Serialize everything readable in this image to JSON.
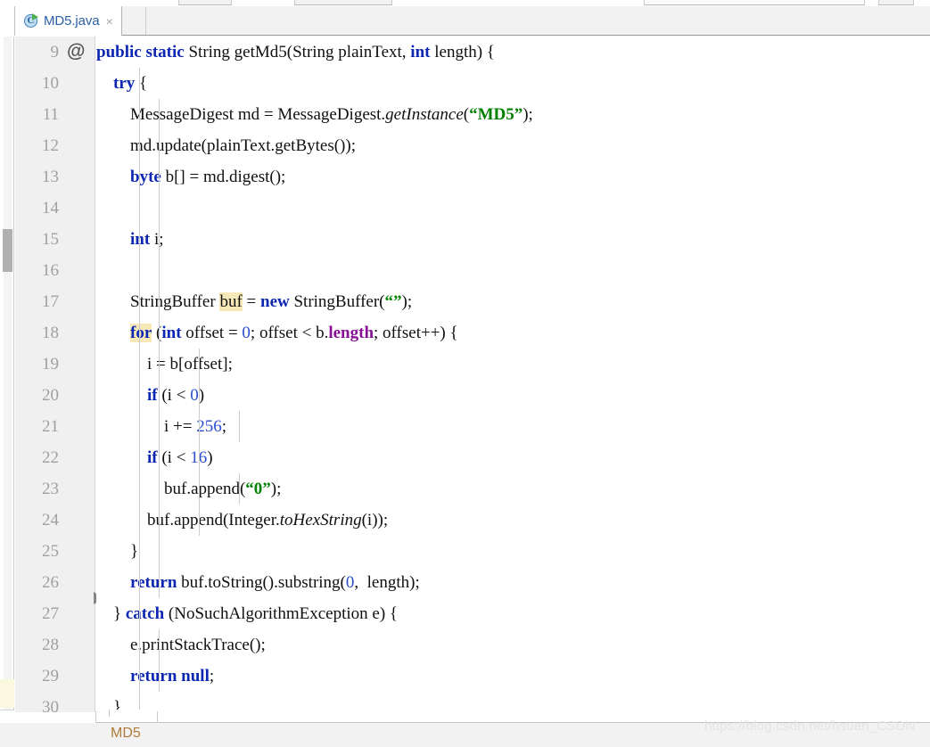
{
  "window": {
    "tab": {
      "title": "MD5.java",
      "icon": "java-class-runnable-icon",
      "icon_letter": "C",
      "close_label": "×"
    }
  },
  "gutter": {
    "line_numbers": [
      "9",
      "10",
      "11",
      "12",
      "13",
      "14",
      "15",
      "16",
      "17",
      "18",
      "19",
      "20",
      "21",
      "22",
      "23",
      "24",
      "25",
      "26",
      "27",
      "28",
      "29",
      "30"
    ],
    "annotation_marker": "@",
    "fold_collapse_icon": "fold-minus-icon",
    "fold_expand_icon": "fold-arrow-icon"
  },
  "status": {
    "breadcrumb": "MD5",
    "watermark": "https://blog.csdn.net/hsuan_CSDN"
  },
  "colors": {
    "keyword": "#0d27b3",
    "number": "#2a4dd0",
    "string": "#008000",
    "field": "#871094",
    "highlight": "#f7e8b8",
    "gutter_bg": "#f0f0f0",
    "line_number": "#a0a0a0",
    "tab_title": "#2b5fa8",
    "breadcrumb": "#b07b39"
  },
  "code": {
    "language": "java",
    "lines": [
      {
        "n": "9",
        "indent": 0,
        "guides": [],
        "tokens": [
          {
            "t": "public",
            "c": "kw"
          },
          {
            "t": " ",
            "c": "plain"
          },
          {
            "t": "static",
            "c": "kw"
          },
          {
            "t": " String getMd5(String plainText, ",
            "c": "plain"
          },
          {
            "t": "int",
            "c": "kw"
          },
          {
            "t": " length) {",
            "c": "plain"
          }
        ]
      },
      {
        "n": "10",
        "indent": 0,
        "guides": [
          0
        ],
        "tokens": [
          {
            "t": "    ",
            "c": "plain"
          },
          {
            "t": "try",
            "c": "kw"
          },
          {
            "t": " {",
            "c": "plain"
          }
        ]
      },
      {
        "n": "11",
        "indent": 0,
        "guides": [
          0,
          1
        ],
        "tokens": [
          {
            "t": "        MessageDigest md = MessageDigest.",
            "c": "plain"
          },
          {
            "t": "getInstance",
            "c": "sm"
          },
          {
            "t": "(",
            "c": "plain"
          },
          {
            "t": "“MD5”",
            "c": "str"
          },
          {
            "t": ");",
            "c": "plain"
          }
        ]
      },
      {
        "n": "12",
        "indent": 0,
        "guides": [
          0,
          1
        ],
        "tokens": [
          {
            "t": "        md.update(plainText.getBytes());",
            "c": "plain"
          }
        ]
      },
      {
        "n": "13",
        "indent": 0,
        "guides": [
          0,
          1
        ],
        "tokens": [
          {
            "t": "        ",
            "c": "plain"
          },
          {
            "t": "byte",
            "c": "kw"
          },
          {
            "t": " b[] = md.digest();",
            "c": "plain"
          }
        ]
      },
      {
        "n": "14",
        "indent": 0,
        "guides": [
          0,
          1
        ],
        "tokens": []
      },
      {
        "n": "15",
        "indent": 0,
        "guides": [
          0,
          1
        ],
        "tokens": [
          {
            "t": "        ",
            "c": "plain"
          },
          {
            "t": "int",
            "c": "kw"
          },
          {
            "t": " i;",
            "c": "plain"
          }
        ]
      },
      {
        "n": "16",
        "indent": 0,
        "guides": [
          0,
          1
        ],
        "tokens": []
      },
      {
        "n": "17",
        "indent": 0,
        "guides": [
          0,
          1
        ],
        "tokens": [
          {
            "t": "        StringBuffer ",
            "c": "plain"
          },
          {
            "t": "buf",
            "c": "plain hl"
          },
          {
            "t": " = ",
            "c": "plain"
          },
          {
            "t": "new",
            "c": "kw"
          },
          {
            "t": " StringBuffer(",
            "c": "plain"
          },
          {
            "t": "“”",
            "c": "str"
          },
          {
            "t": ");",
            "c": "plain"
          }
        ]
      },
      {
        "n": "18",
        "indent": 0,
        "guides": [
          0,
          1
        ],
        "tokens": [
          {
            "t": "        ",
            "c": "plain"
          },
          {
            "t": "for",
            "c": "kw hl"
          },
          {
            "t": " (",
            "c": "plain"
          },
          {
            "t": "int",
            "c": "kw"
          },
          {
            "t": " offset = ",
            "c": "plain"
          },
          {
            "t": "0",
            "c": "num"
          },
          {
            "t": "; offset < b.",
            "c": "plain"
          },
          {
            "t": "length",
            "c": "fld"
          },
          {
            "t": "; offset++) {",
            "c": "plain"
          }
        ]
      },
      {
        "n": "19",
        "indent": 0,
        "guides": [
          0,
          1,
          2
        ],
        "tokens": [
          {
            "t": "            i = b[offset];",
            "c": "plain"
          }
        ]
      },
      {
        "n": "20",
        "indent": 0,
        "guides": [
          0,
          1,
          2
        ],
        "tokens": [
          {
            "t": "            ",
            "c": "plain"
          },
          {
            "t": "if",
            "c": "kw"
          },
          {
            "t": " (i < ",
            "c": "plain"
          },
          {
            "t": "0",
            "c": "num"
          },
          {
            "t": ")",
            "c": "plain"
          }
        ]
      },
      {
        "n": "21",
        "indent": 0,
        "guides": [
          0,
          1,
          2,
          3
        ],
        "tokens": [
          {
            "t": "                i += ",
            "c": "plain"
          },
          {
            "t": "256",
            "c": "num"
          },
          {
            "t": ";",
            "c": "plain"
          }
        ]
      },
      {
        "n": "22",
        "indent": 0,
        "guides": [
          0,
          1,
          2
        ],
        "tokens": [
          {
            "t": "            ",
            "c": "plain"
          },
          {
            "t": "if",
            "c": "kw"
          },
          {
            "t": " (i < ",
            "c": "plain"
          },
          {
            "t": "16",
            "c": "num"
          },
          {
            "t": ")",
            "c": "plain"
          }
        ]
      },
      {
        "n": "23",
        "indent": 0,
        "guides": [
          0,
          1,
          2,
          3
        ],
        "tokens": [
          {
            "t": "                buf.append(",
            "c": "plain"
          },
          {
            "t": "“0”",
            "c": "str"
          },
          {
            "t": ");",
            "c": "plain"
          }
        ]
      },
      {
        "n": "24",
        "indent": 0,
        "guides": [
          0,
          1,
          2
        ],
        "tokens": [
          {
            "t": "            buf.append(Integer.",
            "c": "plain"
          },
          {
            "t": "toHexString",
            "c": "sm"
          },
          {
            "t": "(i));",
            "c": "plain"
          }
        ]
      },
      {
        "n": "25",
        "indent": 0,
        "guides": [
          0,
          1
        ],
        "tokens": [
          {
            "t": "        }",
            "c": "plain"
          }
        ]
      },
      {
        "n": "26",
        "indent": 0,
        "guides": [
          0,
          1
        ],
        "tokens": [
          {
            "t": "        ",
            "c": "plain"
          },
          {
            "t": "return",
            "c": "kw"
          },
          {
            "t": " buf.toString().substring(",
            "c": "plain"
          },
          {
            "t": "0",
            "c": "num"
          },
          {
            "t": ",  length);",
            "c": "plain"
          }
        ]
      },
      {
        "n": "27",
        "indent": 0,
        "guides": [
          0
        ],
        "tokens": [
          {
            "t": "    } ",
            "c": "plain"
          },
          {
            "t": "catch",
            "c": "kw"
          },
          {
            "t": " (NoSuchAlgorithmException e) {",
            "c": "plain"
          }
        ]
      },
      {
        "n": "28",
        "indent": 0,
        "guides": [
          0,
          1
        ],
        "tokens": [
          {
            "t": "        e.printStackTrace();",
            "c": "plain"
          }
        ]
      },
      {
        "n": "29",
        "indent": 0,
        "guides": [
          0,
          1
        ],
        "tokens": [
          {
            "t": "        ",
            "c": "plain"
          },
          {
            "t": "return",
            "c": "kw"
          },
          {
            "t": " ",
            "c": "plain"
          },
          {
            "t": "null",
            "c": "kw"
          },
          {
            "t": ";",
            "c": "plain"
          }
        ]
      },
      {
        "n": "30",
        "indent": 0,
        "guides": [
          0
        ],
        "tokens": [
          {
            "t": "    }",
            "c": "plain"
          }
        ]
      }
    ]
  }
}
